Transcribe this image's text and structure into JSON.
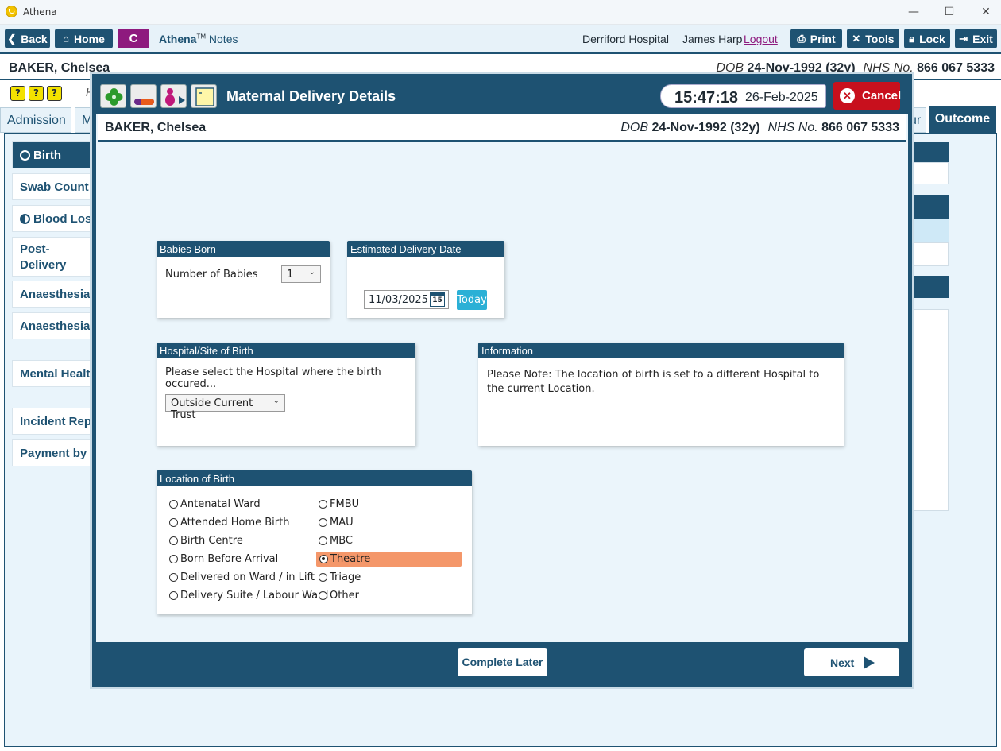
{
  "window": {
    "title": "Athena",
    "min": "—",
    "max": "☐",
    "close": "✕"
  },
  "nav": {
    "back": "Back",
    "home": "Home",
    "badge": "C",
    "app_name": "Athena",
    "tm": "TM",
    "app_sub": "Notes",
    "hospital": "Derriford Hospital",
    "user": "James Harp",
    "logout": "Logout",
    "print": "Print",
    "tools": "Tools",
    "lock": "Lock",
    "exit": "Exit"
  },
  "patient": {
    "name": "BAKER, Chelsea",
    "dob_label": "DOB",
    "dob": "24-Nov-1992 (32y)",
    "nhs_label": "NHS No.",
    "nhs": "866 067 5333"
  },
  "background": {
    "quick_icons": [
      "?",
      "?",
      "?"
    ],
    "h_partial": "H",
    "tabs": [
      "Admission",
      "M",
      "ur"
    ],
    "active_tab": "Outcome",
    "sidebar": [
      "Birth",
      "Swab Count",
      "Blood Loss",
      "Post-Delivery Notes",
      "Anaesthesia In",
      "Anaesthesia F",
      "Mental Health",
      "Incident Repo",
      "Payment by R"
    ]
  },
  "modal": {
    "title": "Maternal Delivery Details",
    "time": "15:47:18",
    "date": "26-Feb-2025",
    "cancel": "Cancel",
    "babies": {
      "header": "Babies Born",
      "label": "Number of Babies",
      "value": "1"
    },
    "edd": {
      "header": "Estimated Delivery Date",
      "value": "11/03/2025",
      "cal_day": "15",
      "today": "Today"
    },
    "hospital_site": {
      "header": "Hospital/Site of Birth",
      "prompt": "Please select the Hospital where the birth occured...",
      "value": "Outside Current Trust"
    },
    "information": {
      "header": "Information",
      "text": "Please Note: The location of birth is set to a different Hospital to the current Location."
    },
    "location": {
      "header": "Location of Birth",
      "left": [
        "Antenatal Ward",
        "Attended Home Birth",
        "Birth Centre",
        "Born Before Arrival",
        "Delivered on Ward / in Lift",
        "Delivery Suite / Labour Ward"
      ],
      "right": [
        "FMBU",
        "MAU",
        "MBC",
        "Theatre",
        "Triage",
        "Other"
      ],
      "selected": "Theatre"
    },
    "complete_later": "Complete Later",
    "next": "Next"
  },
  "colors": {
    "primary": "#1e5272",
    "accent_purple": "#8e1a7e",
    "cancel_red": "#c8101d",
    "selected_option": "#f4976a",
    "today_blue": "#2bb0d6"
  }
}
